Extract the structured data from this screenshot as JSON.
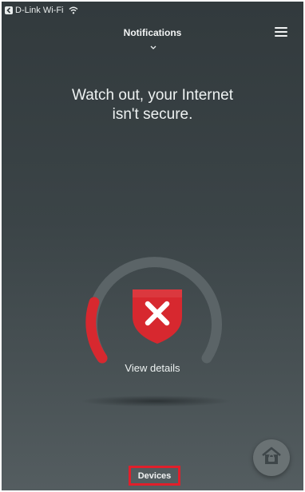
{
  "status_bar": {
    "carrier": "D-Link Wi-Fi",
    "back_icon": "back-arrow-icon",
    "wifi_icon": "wifi-icon"
  },
  "header": {
    "title": "Notifications",
    "chevron_icon": "chevron-down-icon",
    "menu_icon": "hamburger-menu-icon"
  },
  "main": {
    "headline_line1": "Watch out, your Internet",
    "headline_line2": "isn't secure.",
    "gauge": {
      "status_icon": "shield-x-icon",
      "view_details_label": "View details"
    }
  },
  "bottom": {
    "devices_tab_label": "Devices",
    "lock_button_icon": "home-lock-icon"
  },
  "colors": {
    "background_top": "#323a3d",
    "background_bottom": "#545d60",
    "alert_red": "#d7282f",
    "gauge_track": "#5b6467",
    "highlight_box": "#e11f2b"
  }
}
